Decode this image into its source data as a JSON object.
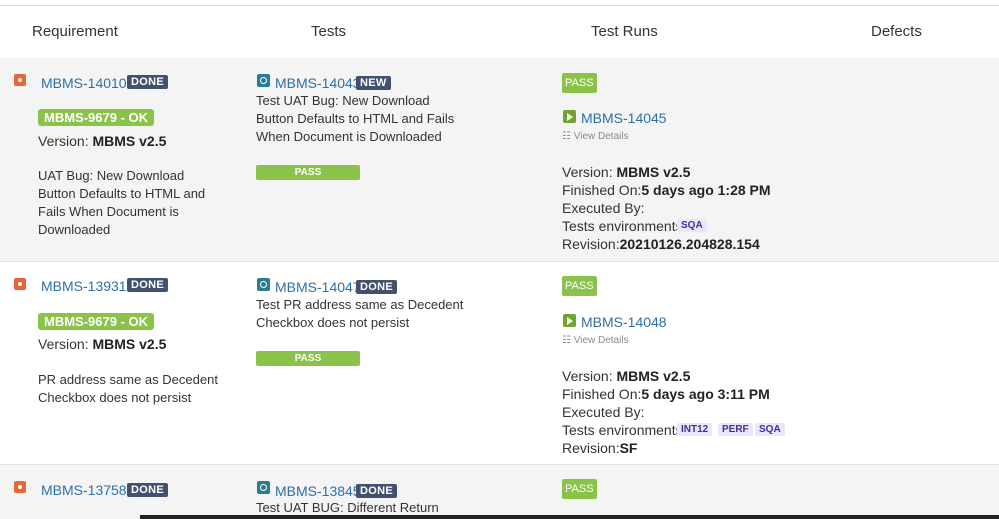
{
  "columns": {
    "requirement": "Requirement",
    "tests": "Tests",
    "test_runs": "Test Runs",
    "defects": "Defects"
  },
  "rows": [
    {
      "req_key": "MBMS-14010",
      "req_status": "DONE",
      "ok_label": "MBMS-9679 - OK",
      "version_label": "Version:",
      "version_value": "MBMS v2.5",
      "req_summary": [
        "UAT Bug: New Download",
        "Button Defaults to HTML and",
        "Fails When Document is",
        "Downloaded"
      ],
      "test_key": "MBMS-14043",
      "test_status": "NEW",
      "test_summary": [
        "Test UAT Bug: New Download",
        "Button Defaults to HTML and Fails",
        "When Document is Downloaded"
      ],
      "test_result": "PASS",
      "run_status": "PASS",
      "run_key": "MBMS-14045",
      "view_details": "View Details",
      "run_version_label": "Version:",
      "run_version_value": "MBMS v2.5",
      "finished_label": "Finished On:",
      "finished_value": "5 days ago 1:28 PM",
      "executed_label": "Executed By:",
      "env_label": "Tests environments:",
      "envs": [
        "SQA"
      ],
      "revision_label": "Revision:",
      "revision_value": "20210126.204828.154"
    },
    {
      "req_key": "MBMS-13931",
      "req_status": "DONE",
      "ok_label": "MBMS-9679 - OK",
      "version_label": "Version:",
      "version_value": "MBMS v2.5",
      "req_summary": [
        "PR address same as Decedent",
        "Checkbox does not persist"
      ],
      "test_key": "MBMS-14047",
      "test_status": "DONE",
      "test_summary": [
        "Test PR address same as Decedent",
        "Checkbox does not persist"
      ],
      "test_result": "PASS",
      "run_status": "PASS",
      "run_key": "MBMS-14048",
      "view_details": "View Details",
      "run_version_label": "Version:",
      "run_version_value": "MBMS v2.5",
      "finished_label": "Finished On:",
      "finished_value": "5 days ago 3:11 PM",
      "executed_label": "Executed By:",
      "env_label": "Tests environments:",
      "envs": [
        "INT12",
        "PERF",
        "SQA"
      ],
      "revision_label": "Revision:",
      "revision_value": "SF"
    },
    {
      "req_key": "MBMS-13758",
      "req_status": "DONE",
      "test_key": "MBMS-13845",
      "test_status": "DONE",
      "test_summary": [
        "Test UAT BUG: Different Return"
      ],
      "run_status": "PASS"
    }
  ]
}
